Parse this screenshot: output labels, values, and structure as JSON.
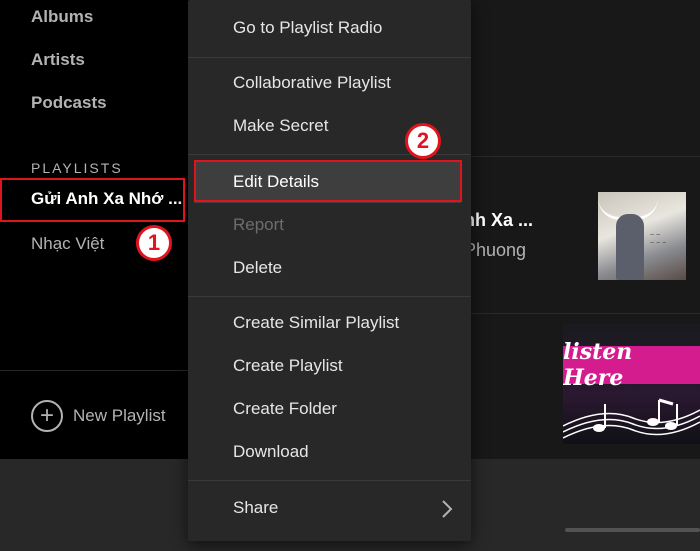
{
  "sidebar": {
    "nav": [
      {
        "label": "Albums"
      },
      {
        "label": "Artists"
      },
      {
        "label": "Podcasts"
      }
    ],
    "playlists_title": "PLAYLISTS",
    "playlists": [
      {
        "label": "Gửi Anh Xa Nhớ ..."
      },
      {
        "label": "Nhạc Việt"
      }
    ],
    "new_playlist": "New Playlist"
  },
  "main": {
    "track_title": "nh Xa ...",
    "track_artist": "Phuong",
    "cover2_text": "listen Here"
  },
  "context_menu": {
    "items": [
      {
        "label": "Go to Playlist Radio"
      },
      {
        "label": "Collaborative Playlist"
      },
      {
        "label": "Make Secret"
      },
      {
        "label": "Edit Details"
      },
      {
        "label": "Report"
      },
      {
        "label": "Delete"
      },
      {
        "label": "Create Similar Playlist"
      },
      {
        "label": "Create Playlist"
      },
      {
        "label": "Create Folder"
      },
      {
        "label": "Download"
      },
      {
        "label": "Share"
      }
    ]
  },
  "annotations": {
    "step1": "1",
    "step2": "2"
  },
  "colors": {
    "highlight": "#e0141e",
    "menu_bg": "#282828",
    "sidebar_bg": "#000000"
  }
}
